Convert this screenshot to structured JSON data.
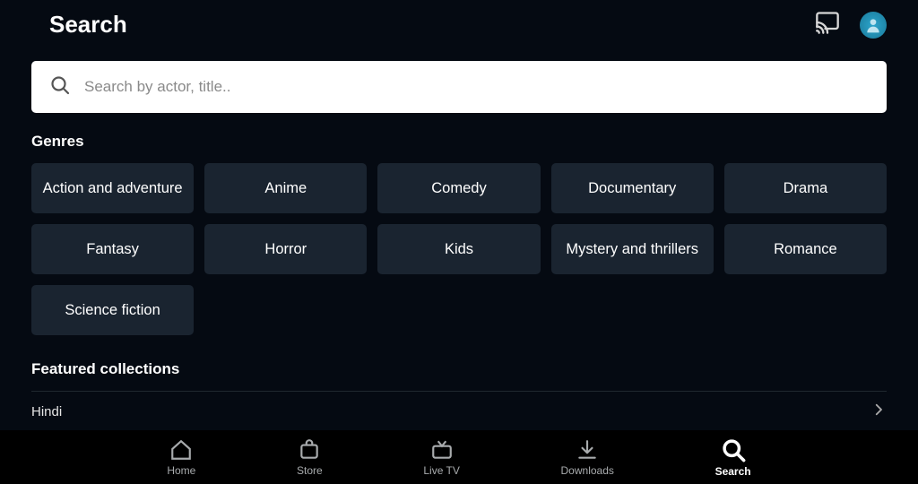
{
  "header": {
    "title": "Search"
  },
  "search": {
    "placeholder": "Search by actor, title..",
    "value": ""
  },
  "sections": {
    "genres_label": "Genres",
    "featured_label": "Featured collections"
  },
  "genres": [
    "Action and adventure",
    "Anime",
    "Comedy",
    "Documentary",
    "Drama",
    "Fantasy",
    "Horror",
    "Kids",
    "Mystery and thrillers",
    "Romance",
    "Science fiction"
  ],
  "collections": [
    "Hindi"
  ],
  "nav": [
    {
      "label": "Home"
    },
    {
      "label": "Store"
    },
    {
      "label": "Live TV"
    },
    {
      "label": "Downloads"
    },
    {
      "label": "Search"
    }
  ]
}
